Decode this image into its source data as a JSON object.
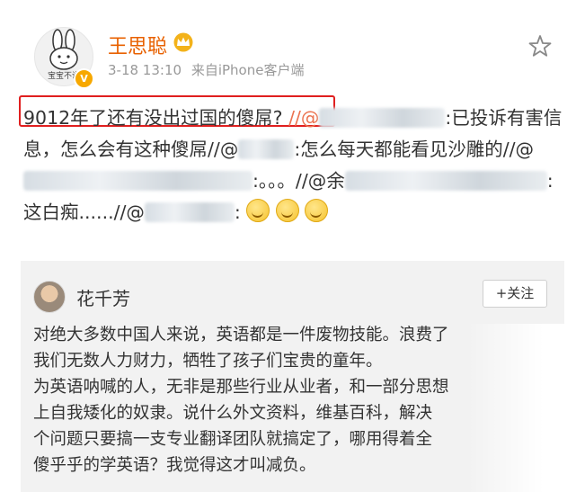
{
  "post": {
    "username": "王思聪",
    "avatar_caption": "宝宝不说",
    "verified_badge": "V",
    "date": "3-18 13:10",
    "source": "来自iPhone客户端",
    "text": {
      "highlight": "9012年了还有没出过国的傻屌?",
      "seg1": " //@",
      "seg2": ":已投诉有害信息，怎么会有这种傻屌//@",
      "seg3": ":怎么每天都能看见沙雕的//@",
      "seg4": ":。。。//@余",
      "seg5": ":这白痴......//@",
      "seg6": ":"
    }
  },
  "repost": {
    "username": "花千芳",
    "follow_label": "+关注",
    "lines": [
      "对绝大多数中国人来说，英语都是一件废物技能。浪费了",
      "我们无数人力财力，牺牲了孩子们宝贵的童年。",
      "为英语呐喊的人，无非是那些行业从业者，和一部分思想",
      "上自我矮化的奴隶。说什么外文资料，维基百科，解决",
      "个问题只要搞一支专业翻译团队就搞定了，哪用得着全",
      "傻乎乎的学英语？我觉得这才叫减负。"
    ]
  },
  "colors": {
    "username": "#e86100",
    "mention": "#eb7350",
    "highlight_border": "#e01f1f",
    "repost_bg": "#f2f2f2"
  },
  "icons": [
    "rabbit-avatar",
    "verified-icon",
    "crown-icon",
    "star-icon",
    "grin-emoji",
    "user-avatar"
  ]
}
